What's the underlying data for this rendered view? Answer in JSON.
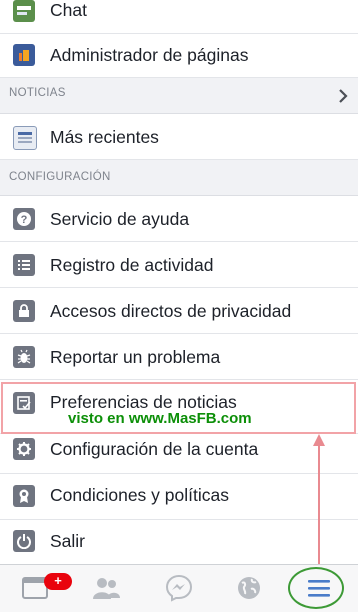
{
  "menu": {
    "chat": "Chat",
    "pages_manager": "Administrador de páginas",
    "news_section": "NOTICIAS",
    "most_recent": "Más recientes",
    "settings_section": "CONFIGURACIÓN",
    "help": "Servicio de ayuda",
    "activity_log": "Registro de actividad",
    "privacy_shortcuts": "Accesos directos de privacidad",
    "report_problem": "Reportar un problema",
    "news_prefs": "Preferencias de noticias",
    "account_settings": "Configuración de la cuenta",
    "terms": "Condiciones y políticas",
    "logout": "Salir"
  },
  "watermark": "visto en www.MasFB.com",
  "tabbar": {
    "notification_badge": "+"
  },
  "colors": {
    "highlight_border": "#f2a3a7",
    "annotation_arrow": "#e98a90",
    "menu_circle": "#3d9a36",
    "watermark_text": "#0c8f08",
    "badge": "#e9030d",
    "active_tab": "#4a7cc9"
  }
}
